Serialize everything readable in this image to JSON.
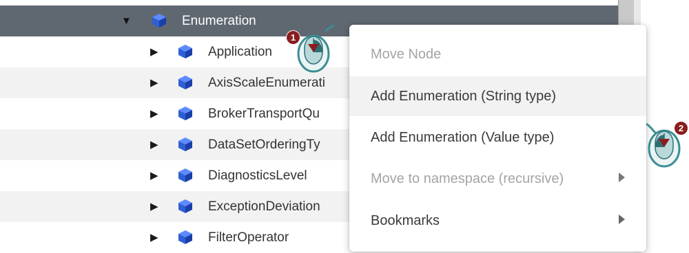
{
  "tree": {
    "items": [
      {
        "label": "Enumeration",
        "expanded": true,
        "selected": true
      },
      {
        "label": "Application"
      },
      {
        "label": "AxisScaleEnumerati"
      },
      {
        "label": "BrokerTransportQu"
      },
      {
        "label": "DataSetOrderingTy"
      },
      {
        "label": "DiagnosticsLevel"
      },
      {
        "label": "ExceptionDeviation"
      },
      {
        "label": "FilterOperator"
      }
    ]
  },
  "context_menu": {
    "items": [
      {
        "label": "Move Node",
        "enabled": false
      },
      {
        "label": "Add Enumeration (String type)",
        "enabled": true,
        "hovered": true
      },
      {
        "label": "Add Enumeration (Value type)",
        "enabled": true
      },
      {
        "label": "Move to namespace (recursive)",
        "enabled": false,
        "submenu": true
      },
      {
        "label": "Bookmarks",
        "enabled": true,
        "submenu": true
      }
    ]
  },
  "callouts": [
    {
      "number": "1",
      "icon": "right-click-mouse-icon"
    },
    {
      "number": "2",
      "icon": "left-click-mouse-icon"
    }
  ],
  "colors": {
    "selected_row": "#5f6770",
    "cube": "#2f5fd6",
    "callout_badge": "#8a1d1d",
    "mouse_teal": "#3d8e93"
  }
}
